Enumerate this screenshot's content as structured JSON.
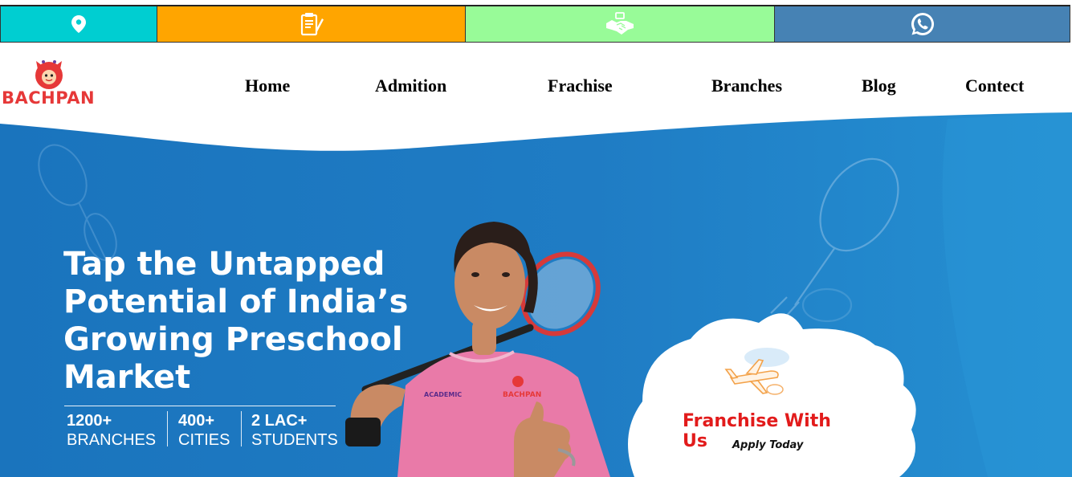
{
  "topbar": {
    "items": [
      {
        "icon": "map-pin-icon",
        "color": "#00ced1"
      },
      {
        "icon": "document-form-icon",
        "color": "#ffa500"
      },
      {
        "icon": "handshake-icon",
        "color": "#98fb98"
      },
      {
        "icon": "whatsapp-icon",
        "color": "#4682b4"
      }
    ]
  },
  "header": {
    "logo_text": "BACHPAN",
    "nav": [
      "Home",
      "Admition",
      "Frachise",
      "Branches",
      "Blog",
      "Contect"
    ]
  },
  "hero": {
    "title_lines": [
      "Tap the Untapped",
      "Potential of India’s",
      "Growing Preschool",
      "Market"
    ],
    "stats": [
      {
        "number": "1200+",
        "label": "BRANCHES"
      },
      {
        "number": "400+",
        "label": "CITIES"
      },
      {
        "number": "2 LAC+",
        "label": "STUDENTS"
      }
    ],
    "jersey_text": "BACHPAN",
    "cta_title": "Franchise With Us",
    "cta_subtitle": "Apply Today",
    "brand_blue": "#1f7cc4",
    "accent_red": "#e21b1b"
  }
}
